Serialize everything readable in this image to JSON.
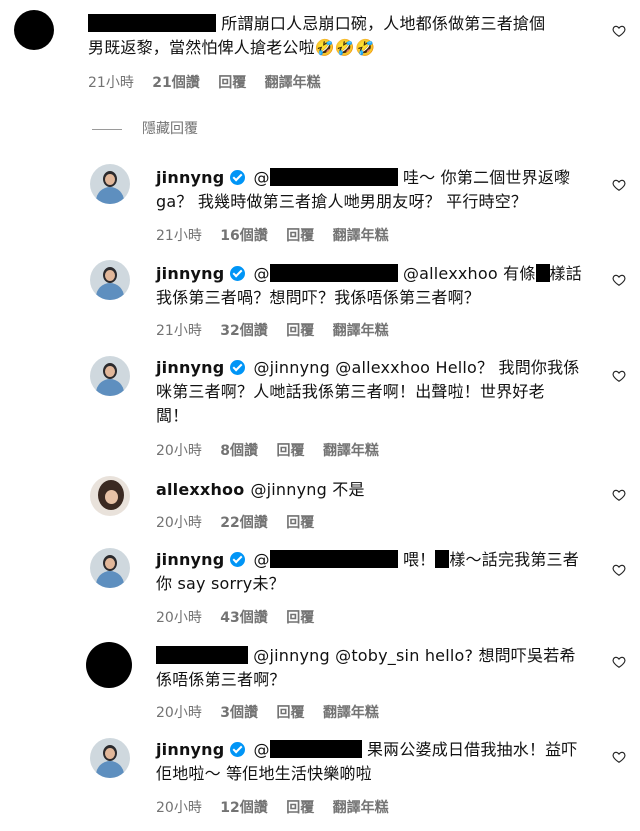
{
  "comments": [
    {
      "line1": "所謂崩口人忌崩口碗，人地都係做第三者搶個",
      "line2": "男既返黎，當然怕俾人搶老公啦🤣🤣🤣",
      "time": "21小時",
      "likes": "21個讚",
      "reply": "回覆",
      "translate": "翻譯年糕"
    },
    {
      "username": "jinnyng",
      "prefix": "@",
      "line1_after": "哇～ 你第二個世界返嚟",
      "line2": "ga？ 我幾時做第三者搶人哋男朋友呀？ 平行時空？",
      "time": "21小時",
      "likes": "16個讚",
      "reply": "回覆",
      "translate": "翻譯年糕"
    },
    {
      "username": "jinnyng",
      "prefix": "@",
      "line1_after": "@allexxhoo 有條",
      "line1_end": "樣話",
      "line2": "我係第三者喎？想問吓？我係唔係第三者啊？",
      "time": "21小時",
      "likes": "32個讚",
      "reply": "回覆",
      "translate": "翻譯年糕"
    },
    {
      "username": "jinnyng",
      "line1_after": "@jinnyng @allexxhoo Hello？ 我問你我係",
      "line2": "咪第三者啊？人哋話我係第三者啊！出聲啦！世界好老",
      "line3": "闆！",
      "time": "20小時",
      "likes": "8個讚",
      "reply": "回覆",
      "translate": "翻譯年糕"
    },
    {
      "username": "allexxhoo",
      "line1_after": "@jinnyng 不是",
      "time": "20小時",
      "likes": "22個讚",
      "reply": "回覆"
    },
    {
      "username": "jinnyng",
      "prefix": "@",
      "line1_after": "喂！",
      "line1_end": "樣～話完我第三者",
      "line2": "你 say sorry未？",
      "time": "20小時",
      "likes": "43個讚",
      "reply": "回覆"
    },
    {
      "line1_after": "@jinnyng @toby_sin hello? 想問吓吳若希",
      "line2": "係唔係第三者啊？",
      "time": "20小時",
      "likes": "3個讚",
      "reply": "回覆",
      "translate": "翻譯年糕"
    },
    {
      "username": "jinnyng",
      "prefix": "@",
      "line1_after": "果兩公婆成日借我抽水！益吓",
      "line2": "佢地啦～ 等佢地生活快樂啲啦",
      "time": "20小時",
      "likes": "12個讚",
      "reply": "回覆",
      "translate": "翻譯年糕"
    }
  ],
  "hidden_replies": "隱藏回覆",
  "icons": {
    "like": "heart-icon",
    "verified": "verified-badge-icon"
  },
  "colors": {
    "verified": "#0095f6",
    "meta": "#737373"
  }
}
